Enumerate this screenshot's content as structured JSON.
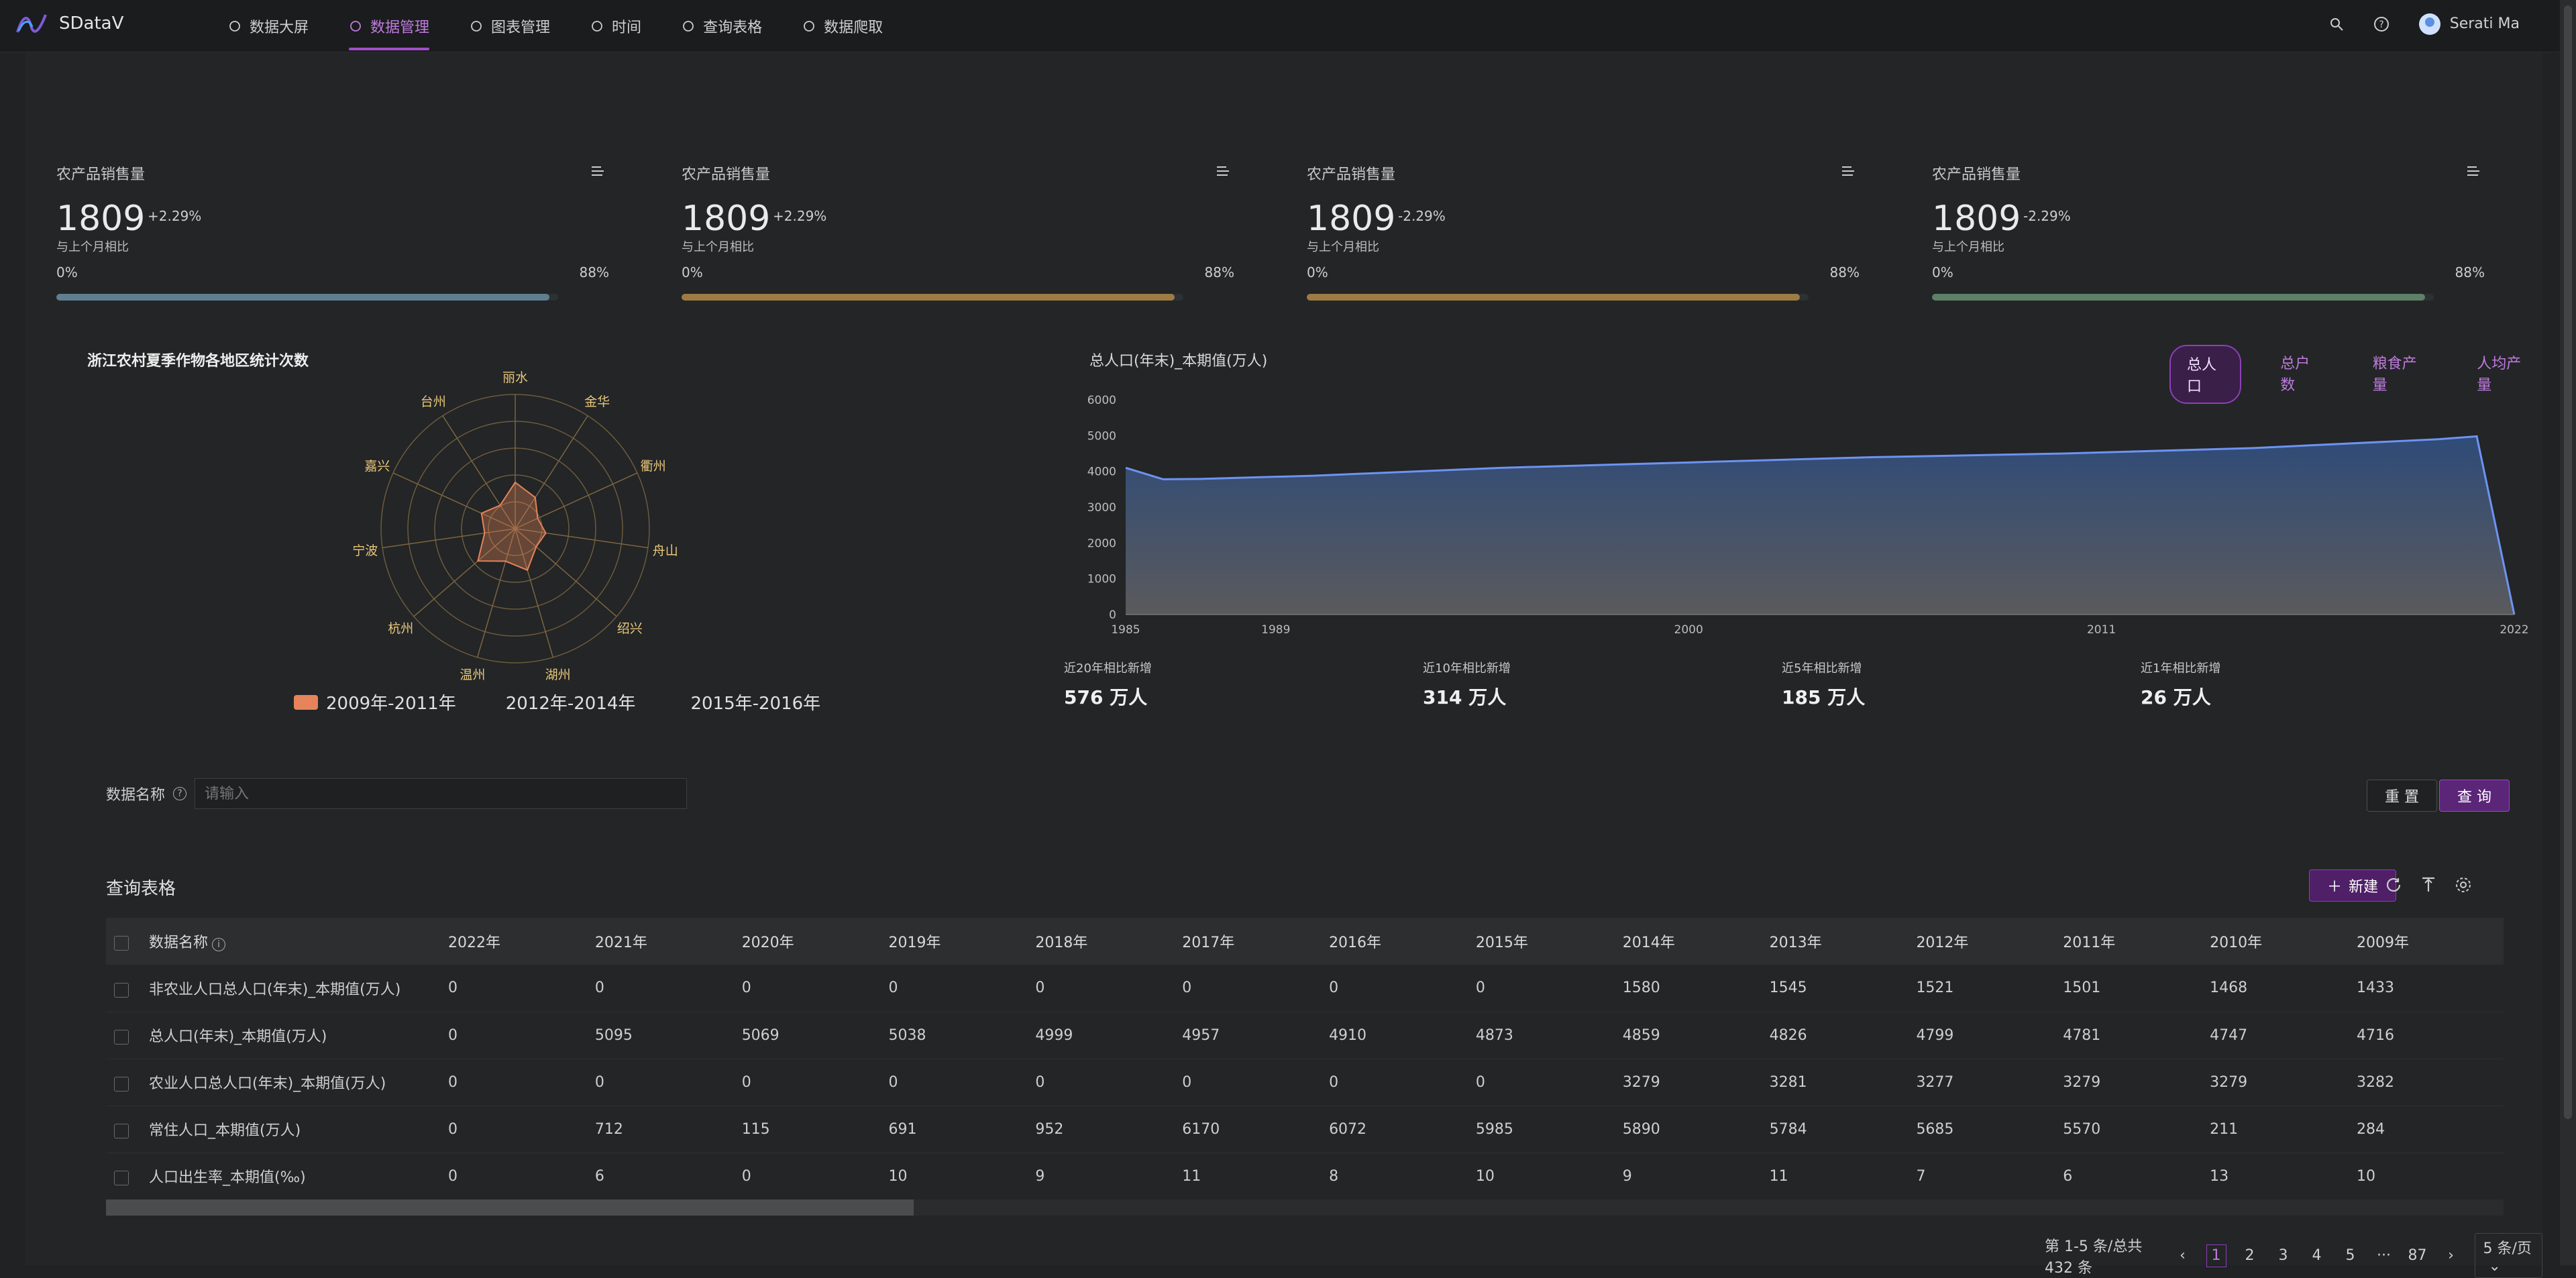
{
  "app": {
    "name": "SDataV",
    "user": "Serati Ma"
  },
  "nav": [
    {
      "label": "数据大屏"
    },
    {
      "label": "数据管理"
    },
    {
      "label": "图表管理"
    },
    {
      "label": "时间"
    },
    {
      "label": "查询表格"
    },
    {
      "label": "数据爬取"
    }
  ],
  "cards": [
    {
      "title": "农产品销售量",
      "value": "1809",
      "change": "+2.29%",
      "sub": "与上个月相比",
      "start": "0%",
      "end": "88%",
      "progress": 0.88,
      "color": "#5f7f8f"
    },
    {
      "title": "农产品销售量",
      "value": "1809",
      "change": "+2.29%",
      "sub": "与上个月相比",
      "start": "0%",
      "end": "88%",
      "progress": 0.88,
      "color": "#9c7c44"
    },
    {
      "title": "农产品销售量",
      "value": "1809",
      "change": "-2.29%",
      "sub": "与上个月相比",
      "start": "0%",
      "end": "88%",
      "progress": 0.88,
      "color": "#9c7c44"
    },
    {
      "title": "农产品销售量",
      "value": "1809",
      "change": "-2.29%",
      "sub": "与上个月相比",
      "start": "0%",
      "end": "88%",
      "progress": 0.88,
      "color": "#5d8067"
    }
  ],
  "chart_data": [
    {
      "type": "radar",
      "title": "浙江农村夏季作物各地区统计次数",
      "axes": [
        "丽水",
        "金华",
        "衢州",
        "舟山",
        "绍兴",
        "湖州",
        "温州",
        "杭州",
        "宁波",
        "嘉兴",
        "台州"
      ],
      "series": [
        {
          "name": "2009年-2011年",
          "values": [
            15,
            12,
            8,
            10,
            9,
            14,
            11,
            16,
            10,
            12,
            9
          ],
          "color": "#e6835a"
        },
        {
          "name": "2012年-2014年",
          "values": [],
          "color": "#e0e0e0"
        },
        {
          "name": "2015年-2016年",
          "values": [],
          "color": "#e0e0e0"
        }
      ]
    },
    {
      "type": "area",
      "title": "总人口(年末)_本期值(万人)",
      "x_ticks": [
        "1985",
        "1989",
        "2000",
        "2011",
        "2022"
      ],
      "y_ticks": [
        "0",
        "1000",
        "2000",
        "3000",
        "4000",
        "5000",
        "6000"
      ],
      "ylim": [
        0,
        6000
      ],
      "series": [
        {
          "name": "总人口",
          "x": [
            1985,
            1986,
            1987,
            1990,
            1995,
            2000,
            2005,
            2010,
            2015,
            2020,
            2021,
            2022
          ],
          "values": [
            4100,
            3780,
            3790,
            3880,
            4100,
            4250,
            4400,
            4500,
            4650,
            4900,
            4980,
            0
          ]
        }
      ]
    }
  ],
  "segments": [
    {
      "label": "总人口",
      "active": true
    },
    {
      "label": "总户数"
    },
    {
      "label": "粮食产量"
    },
    {
      "label": "人均产量"
    }
  ],
  "stats": [
    {
      "label": "近20年相比新增",
      "value": "576 万人"
    },
    {
      "label": "近10年相比新增",
      "value": "314 万人"
    },
    {
      "label": "近5年相比新增",
      "value": "185 万人"
    },
    {
      "label": "近1年相比新增",
      "value": "26 万人"
    }
  ],
  "filter": {
    "label": "数据名称",
    "placeholder": "请输入",
    "reset": "重 置",
    "query": "查 询"
  },
  "table": {
    "title": "查询表格",
    "new_label": "新建",
    "headers": [
      "数据名称",
      "2022年",
      "2021年",
      "2020年",
      "2019年",
      "2018年",
      "2017年",
      "2016年",
      "2015年",
      "2014年",
      "2013年",
      "2012年",
      "2011年",
      "2010年",
      "2009年"
    ],
    "rows": [
      [
        "非农业人口总人口(年末)_本期值(万人)",
        "0",
        "0",
        "0",
        "0",
        "0",
        "0",
        "0",
        "0",
        "1580",
        "1545",
        "1521",
        "1501",
        "1468",
        "1433"
      ],
      [
        "总人口(年末)_本期值(万人)",
        "0",
        "5095",
        "5069",
        "5038",
        "4999",
        "4957",
        "4910",
        "4873",
        "4859",
        "4826",
        "4799",
        "4781",
        "4747",
        "4716"
      ],
      [
        "农业人口总人口(年末)_本期值(万人)",
        "0",
        "0",
        "0",
        "0",
        "0",
        "0",
        "0",
        "0",
        "3279",
        "3281",
        "3277",
        "3279",
        "3279",
        "3282"
      ],
      [
        "常住人口_本期值(万人)",
        "0",
        "712",
        "115",
        "691",
        "952",
        "6170",
        "6072",
        "5985",
        "5890",
        "5784",
        "5685",
        "5570",
        "211",
        "284"
      ],
      [
        "人口出生率_本期值(‰)",
        "0",
        "6",
        "0",
        "10",
        "9",
        "11",
        "8",
        "10",
        "9",
        "11",
        "7",
        "6",
        "13",
        "10"
      ]
    ]
  },
  "pager": {
    "total": "第 1-5 条/总共 432 条",
    "pages": [
      "1",
      "2",
      "3",
      "4",
      "5",
      "···",
      "87"
    ],
    "size": "5 条/页"
  }
}
